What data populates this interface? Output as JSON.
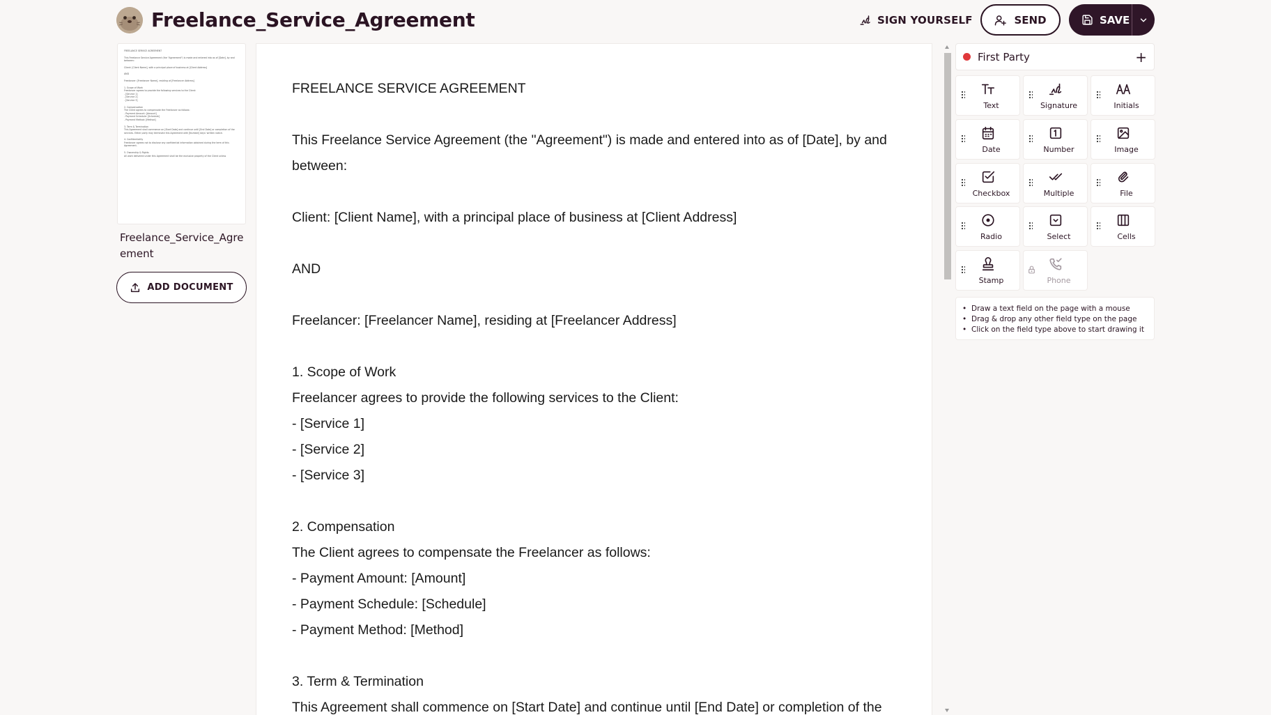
{
  "header": {
    "title": "Freelance_Service_Agreement",
    "sign_yourself_label": "SIGN YOURSELF",
    "send_label": "SEND",
    "save_label": "SAVE"
  },
  "sidebar": {
    "document_name": "Freelance_Service_Agreement",
    "add_document_label": "ADD DOCUMENT",
    "thumbnail_lines": [
      "FREELANCE SERVICE AGREEMENT",
      "",
      "This Freelance Service Agreement (the \"Agreement\") is made and entered into as of [Date], by and",
      "between:",
      "",
      "Client: [Client Name], with a principal place of business at [Client Address]",
      "",
      "AND",
      "",
      "Freelancer: [Freelancer Name], residing at [Freelancer Address]",
      "",
      "1. Scope of Work",
      "Freelancer agrees to provide the following services to the Client:",
      "- [Service 1]",
      "- [Service 2]",
      "- [Service 3]",
      "",
      "2. Compensation",
      "The Client agrees to compensate the Freelancer as follows:",
      "- Payment Amount: [Amount]",
      "- Payment Schedule: [Schedule]",
      "- Payment Method: [Method]",
      "",
      "3. Term & Termination",
      "This Agreement shall commence on [Start Date] and continue until [End Date] or completion of the",
      "services. Either party may terminate this Agreement with [Number] days' written notice.",
      "",
      "4. Confidentiality",
      "Freelancer agrees not to disclose any confidential information obtained during the term of this",
      "Agreement.",
      "",
      "5. Ownership & Rights",
      "All work delivered under this Agreement shall be the exclusive property of the Client unless"
    ]
  },
  "document": {
    "lines": [
      "FREELANCE SERVICE AGREEMENT",
      "",
      "This Freelance Service Agreement (the \"Agreement\") is made and entered into as of [Date], by and",
      "between:",
      "",
      "Client: [Client Name], with a principal place of business at [Client Address]",
      "",
      "AND",
      "",
      "Freelancer: [Freelancer Name], residing at [Freelancer Address]",
      "",
      "1. Scope of Work",
      "Freelancer agrees to provide the following services to the Client:",
      "- [Service 1]",
      "- [Service 2]",
      "- [Service 3]",
      "",
      "2. Compensation",
      "The Client agrees to compensate the Freelancer as follows:",
      "- Payment Amount: [Amount]",
      "- Payment Schedule: [Schedule]",
      "- Payment Method: [Method]",
      "",
      "3. Term & Termination",
      "This Agreement shall commence on [Start Date] and continue until [End Date] or completion of the"
    ]
  },
  "party": {
    "name": "First Party",
    "color": "#e0383b"
  },
  "fields": [
    {
      "label": "Text",
      "icon": "text-icon"
    },
    {
      "label": "Signature",
      "icon": "signature-icon"
    },
    {
      "label": "Initials",
      "icon": "initials-icon"
    },
    {
      "label": "Date",
      "icon": "calendar-icon"
    },
    {
      "label": "Number",
      "icon": "number-icon"
    },
    {
      "label": "Image",
      "icon": "image-icon"
    },
    {
      "label": "Checkbox",
      "icon": "checkbox-icon"
    },
    {
      "label": "Multiple",
      "icon": "double-check-icon"
    },
    {
      "label": "File",
      "icon": "paperclip-icon"
    },
    {
      "label": "Radio",
      "icon": "radio-icon"
    },
    {
      "label": "Select",
      "icon": "select-icon"
    },
    {
      "label": "Cells",
      "icon": "cells-icon"
    },
    {
      "label": "Stamp",
      "icon": "stamp-icon"
    },
    {
      "label": "Phone",
      "icon": "phone-icon",
      "locked": true
    }
  ],
  "tips": [
    "Draw a text field on the page with a mouse",
    "Drag & drop any other field type on the page",
    "Click on the field type above to start drawing it"
  ],
  "colors": {
    "brand_dark": "#2f1628",
    "background": "#f9f7f6",
    "party_dot": "#e0383b"
  }
}
